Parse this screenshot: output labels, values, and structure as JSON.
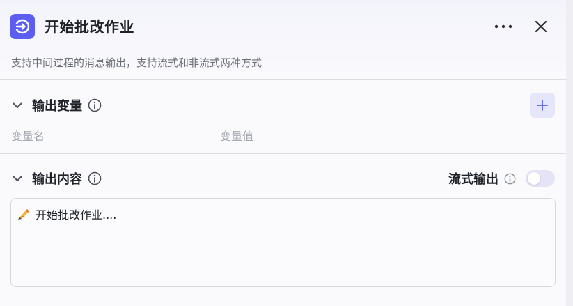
{
  "header": {
    "title": "开始批改作业",
    "icon": "arrow-right-circle-icon",
    "accent_color": "#5b5ef0"
  },
  "description": "支持中间过程的消息输出，支持流式和非流式两种方式",
  "output_variables": {
    "title": "输出变量",
    "columns": [
      "变量名",
      "变量值"
    ]
  },
  "output_content": {
    "title": "输出内容",
    "stream_label": "流式输出",
    "stream_enabled": false,
    "content": "开始批改作业....",
    "content_emoji": "✍"
  }
}
